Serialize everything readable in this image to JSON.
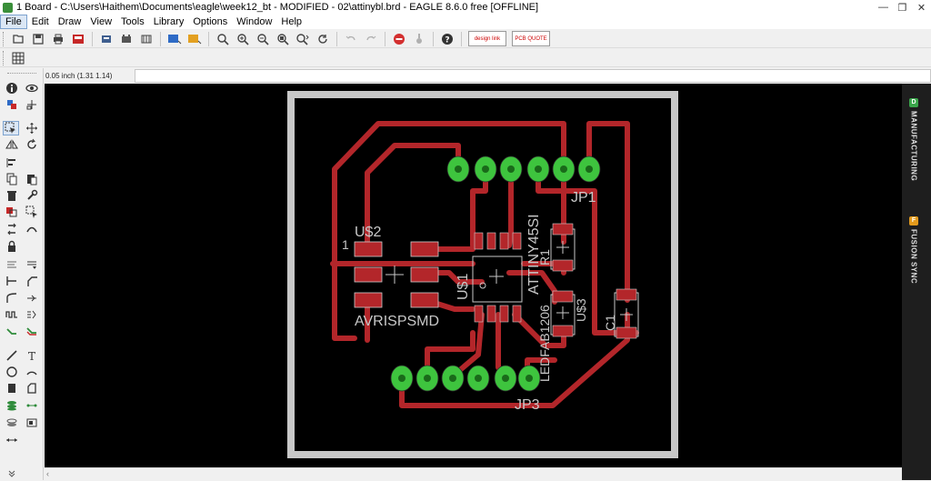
{
  "window": {
    "title": "1 Board - C:\\Users\\Haithem\\Documents\\eagle\\week12_bt - MODIFIED - 02\\attinybl.brd - EAGLE 8.6.0 free [OFFLINE]",
    "controls": {
      "minimize": "—",
      "restore": "❐",
      "close": "✕"
    }
  },
  "menu": [
    "File",
    "Edit",
    "Draw",
    "View",
    "Tools",
    "Library",
    "Options",
    "Window",
    "Help"
  ],
  "toolbar": {
    "design_link": "design link",
    "pcb_quote": "PCB QUOTE"
  },
  "command": {
    "coordinate": "0.05 inch (1.31 1.14)",
    "value": ""
  },
  "right_panel": {
    "tabs": [
      {
        "badge": "D",
        "label": "MANUFACTURING",
        "color": "#3aa64b"
      },
      {
        "badge": "F",
        "label": "FUSION SYNC",
        "color": "#e39a1c"
      }
    ]
  },
  "board": {
    "colors": {
      "board_outline": "#c8c8c8",
      "trace": "#b3262a",
      "pad": "#3ec43e",
      "smd": "#b3262a",
      "silk": "#c8c8c8"
    },
    "labels": {
      "jp1": "JP1",
      "jp3": "JP3",
      "u2": "U$2",
      "u2_pin1": "1",
      "avrisp": "AVRISPSMD",
      "u1": "U$1",
      "attiny": "ATTINY45SI",
      "r1": "R1",
      "u3": "U$3",
      "ledfab": "LEDFAB1206",
      "c1": "C1"
    }
  }
}
